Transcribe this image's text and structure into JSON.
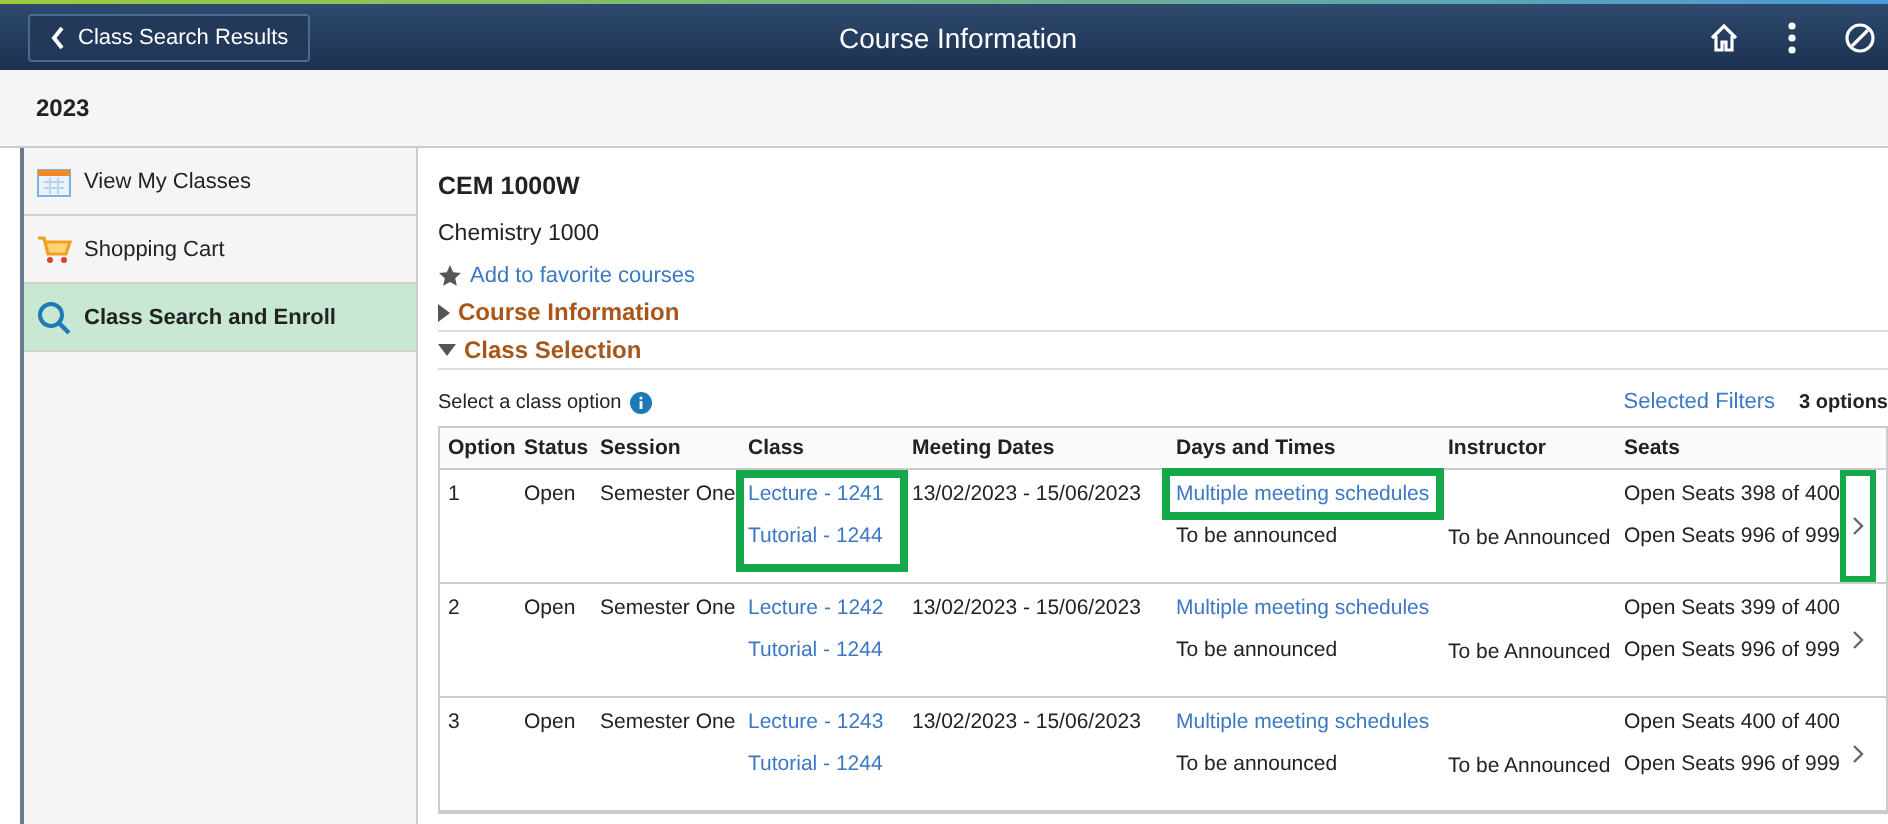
{
  "header": {
    "back_button": "Class Search Results",
    "title": "Course Information"
  },
  "term": "2023",
  "sidebar": {
    "items": [
      {
        "label": "View My Classes",
        "selected": false
      },
      {
        "label": "Shopping Cart",
        "selected": false
      },
      {
        "label": "Class Search and Enroll",
        "selected": true
      }
    ]
  },
  "course": {
    "code": "CEM 1000W",
    "name": "Chemistry 1000",
    "favorite_link": "Add to favorite courses",
    "sections": [
      {
        "label": "Course Information",
        "expanded": false
      },
      {
        "label": "Class Selection",
        "expanded": true
      }
    ]
  },
  "class_selection": {
    "prompt": "Select a class option",
    "filters_link": "Selected Filters",
    "count": "3 options",
    "columns": [
      "Option",
      "Status",
      "Session",
      "Class",
      "Meeting Dates",
      "Days and Times",
      "Instructor",
      "Seats"
    ],
    "rows": [
      {
        "option": "1",
        "status": "Open",
        "session": "Semester One",
        "classes": [
          "Lecture - 1241",
          "Tutorial - 1244"
        ],
        "dates": "13/02/2023 - 15/06/2023",
        "days": "Multiple meeting schedules",
        "days_note": "To be announced",
        "instructor": "To be Announced",
        "seats": [
          "Open Seats 398 of 400",
          "Open Seats 996 of 999"
        ],
        "highlighted": true
      },
      {
        "option": "2",
        "status": "Open",
        "session": "Semester One",
        "classes": [
          "Lecture - 1242",
          "Tutorial - 1244"
        ],
        "dates": "13/02/2023 - 15/06/2023",
        "days": "Multiple meeting schedules",
        "days_note": "To be announced",
        "instructor": "To be Announced",
        "seats": [
          "Open Seats 399 of 400",
          "Open Seats 996 of 999"
        ],
        "highlighted": false
      },
      {
        "option": "3",
        "status": "Open",
        "session": "Semester One",
        "classes": [
          "Lecture - 1243",
          "Tutorial - 1244"
        ],
        "dates": "13/02/2023 - 15/06/2023",
        "days": "Multiple meeting schedules",
        "days_note": "To be announced",
        "instructor": "To be Announced",
        "seats": [
          "Open Seats 400 of 400",
          "Open Seats 996 of 999"
        ],
        "highlighted": false
      }
    ]
  }
}
